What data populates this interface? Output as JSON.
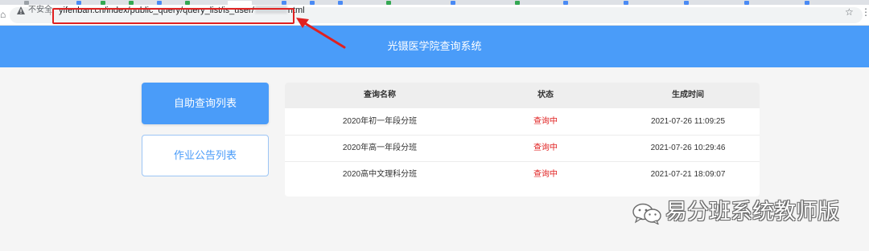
{
  "browser": {
    "security_label": "不安全",
    "url_prefix": "yifenban.cn/index/public_query/query_list/is_user/",
    "url_suffix": "ntml",
    "icons": [
      "home-icon",
      "warning-icon",
      "star-icon",
      "menu-icon"
    ],
    "highlight_color": "#e02020"
  },
  "header": {
    "title": "光镊医学院查询系统",
    "color": "#4a9cf9"
  },
  "sidebar": {
    "buttons": [
      {
        "label": "自助查询列表",
        "active": true
      },
      {
        "label": "作业公告列表",
        "active": false
      }
    ]
  },
  "table": {
    "columns": [
      "查询名称",
      "状态",
      "生成时间"
    ],
    "rows": [
      {
        "name": "2020年初一年段分班",
        "status": "查询中",
        "time": "2021-07-26 11:09:25"
      },
      {
        "name": "2020年高一年段分班",
        "status": "查询中",
        "time": "2021-07-26 10:29:46"
      },
      {
        "name": "2020高中文理科分班",
        "status": "查询中",
        "time": "2021-07-21 18:09:07"
      }
    ],
    "status_color": "#e02020"
  },
  "watermark": {
    "text": "易分班系统教师版",
    "icon": "wechat-icon"
  }
}
